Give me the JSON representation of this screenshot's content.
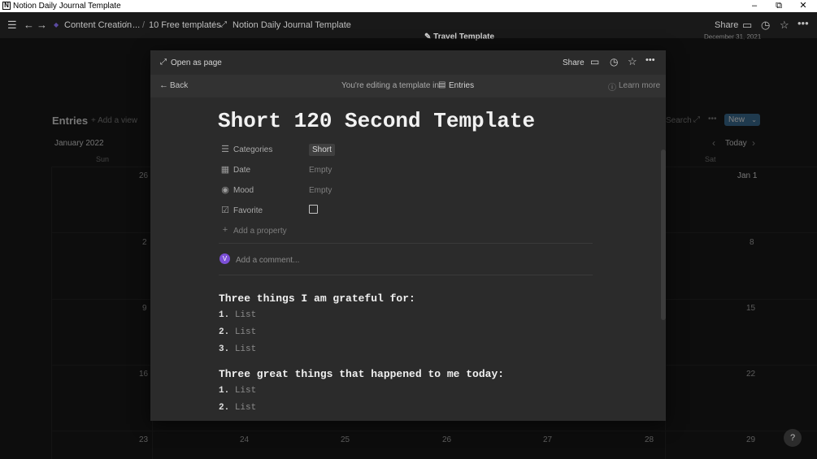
{
  "window": {
    "title": "Notion Daily Journal Template",
    "minimize": "–",
    "restore": "⧉",
    "close": "✕"
  },
  "topnav": {
    "breadcrumbs": [
      "Content Creation",
      "...",
      "10 Free templates",
      "Notion Daily Journal Template"
    ],
    "share_label": "Share"
  },
  "background": {
    "partial_title": "Travel Template",
    "partial_date": "December 31, 2021",
    "db_title": "Entries",
    "add_view_label": "Add a view",
    "month_label": "January 2022",
    "search_label": "Search",
    "new_label": "New",
    "today_label": "Today",
    "weekdays": [
      "Sun",
      "Sat"
    ],
    "day_numbers": {
      "left": [
        "26",
        "2",
        "9",
        "16",
        "23"
      ],
      "right": [
        "Jan 1",
        "8",
        "15",
        "22",
        "29"
      ],
      "bottom": [
        "24",
        "25",
        "26",
        "27",
        "28"
      ]
    },
    "help_label": "?"
  },
  "modal": {
    "open_as_page_label": "Open as page",
    "share_label": "Share",
    "back_label": "Back",
    "editing_text": "You're editing a template in",
    "editing_target": "Entries",
    "learn_more_label": "Learn more",
    "page_title": "Short 120 Second Template",
    "properties": [
      {
        "icon": "list-icon",
        "name": "Categories",
        "value": "Short"
      },
      {
        "icon": "calendar-icon",
        "name": "Date",
        "value": "Empty"
      },
      {
        "icon": "select-icon",
        "name": "Mood",
        "value": "Empty"
      },
      {
        "icon": "checkbox-icon",
        "name": "Favorite",
        "value": ""
      }
    ],
    "add_property_label": "Add a property",
    "avatar_letter": "V",
    "comment_placeholder": "Add a comment...",
    "sections": [
      {
        "heading": "Three things I am grateful for:",
        "items": [
          {
            "num": "1.",
            "text": "List"
          },
          {
            "num": "2.",
            "text": "List"
          },
          {
            "num": "3.",
            "text": "List"
          }
        ]
      },
      {
        "heading": "Three great things that happened to me today:",
        "items": [
          {
            "num": "1.",
            "text": "List"
          },
          {
            "num": "2.",
            "text": "List"
          }
        ]
      }
    ]
  },
  "colors": {
    "background": "#191919",
    "modal": "#2b2b2b",
    "accent_new_button": "#3a6a8f",
    "avatar": "#7b4fd6",
    "tag_bg": "#3f3f3f"
  }
}
